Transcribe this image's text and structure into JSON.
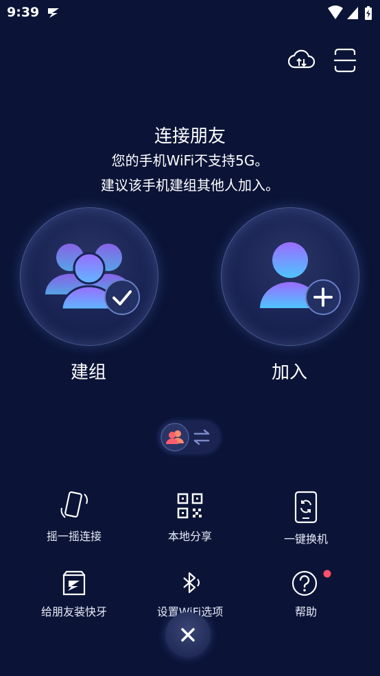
{
  "status_bar": {
    "time": "9:39",
    "app_icon": "zapya-logo-icon",
    "icons": [
      "wifi-icon",
      "cellular-signal-icon",
      "battery-charging-icon"
    ]
  },
  "toolbar": {
    "icons": [
      "cloud-transfer-icon",
      "scan-icon"
    ]
  },
  "header": {
    "title": "连接朋友",
    "line1": "您的手机WiFi不支持5G。",
    "line2": "建议该手机建组其他人加入。"
  },
  "actions": {
    "create_label": "建组",
    "join_label": "加入"
  },
  "toggle": {
    "icons": [
      "people-icon",
      "swap-arrows-icon"
    ]
  },
  "grid": [
    {
      "label": "摇一摇连接",
      "icon": "shake-phone-icon"
    },
    {
      "label": "本地分享",
      "icon": "qr-code-icon"
    },
    {
      "label": "一键换机",
      "icon": "phone-switch-icon"
    },
    {
      "label": "给朋友装快牙",
      "icon": "zapya-box-icon"
    },
    {
      "label": "设置WiFi选项",
      "icon": "bluetooth-icon"
    },
    {
      "label": "帮助",
      "icon": "help-icon",
      "badge": true
    }
  ],
  "colors": {
    "background": "#0b1437",
    "accent_blue": "#4fb4ff",
    "accent_purple": "#8a6cff",
    "badge_red": "#ff4f6a"
  }
}
